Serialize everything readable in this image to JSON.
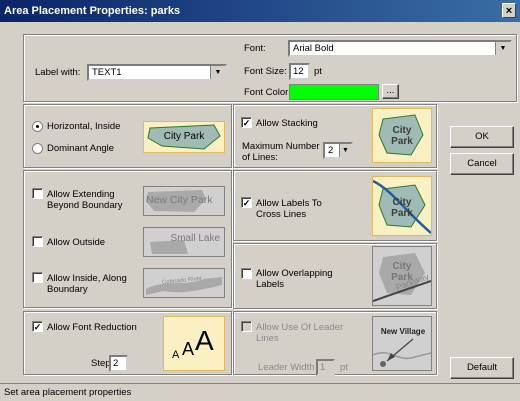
{
  "title": "Area Placement Properties: parks",
  "close_glyph": "×",
  "label_with": {
    "label": "Label with:",
    "value": "TEXT1"
  },
  "font": {
    "label": "Font:",
    "value": "Arial Bold"
  },
  "font_size": {
    "label": "Font Size:",
    "value": "12",
    "unit": "pt"
  },
  "font_color": {
    "label": "Font Color:",
    "color": "#00ff00",
    "button": "..."
  },
  "orientation": {
    "horizontal": "Horizontal, Inside",
    "dominant": "Dominant Angle",
    "selected": "horizontal",
    "preview": "City Park"
  },
  "extend": {
    "beyond": {
      "label": "Allow Extending Beyond Boundary",
      "checked": false,
      "preview": "New City Park"
    },
    "outside": {
      "label": "Allow Outside",
      "checked": false,
      "preview": "Small Lake"
    },
    "inside_along": {
      "label": "Allow Inside, Along Boundary",
      "checked": false,
      "preview": "Colorado River"
    }
  },
  "font_reduction": {
    "label": "Allow Font Reduction",
    "checked": true,
    "steps_label": "Steps",
    "steps": "2"
  },
  "stacking": {
    "label": "Allow Stacking",
    "checked": true,
    "max_lines_label": "Maximum Number of Lines:",
    "max_lines": "2",
    "preview": [
      "City",
      "Park"
    ]
  },
  "cross_lines": {
    "label": "Allow Labels To Cross Lines",
    "checked": true,
    "preview": [
      "City",
      "Park"
    ]
  },
  "overlapping": {
    "label": "Allow Overlapping Labels",
    "checked": false,
    "preview": [
      "City",
      "Park",
      "Parkway"
    ]
  },
  "leader": {
    "label": "Allow Use Of Leader Lines",
    "checked": false,
    "width_label": "Leader Width",
    "width": "1",
    "unit": "pt",
    "preview": "New Village"
  },
  "buttons": {
    "ok": "OK",
    "cancel": "Cancel",
    "default": "Default"
  },
  "status": "Set area placement properties"
}
